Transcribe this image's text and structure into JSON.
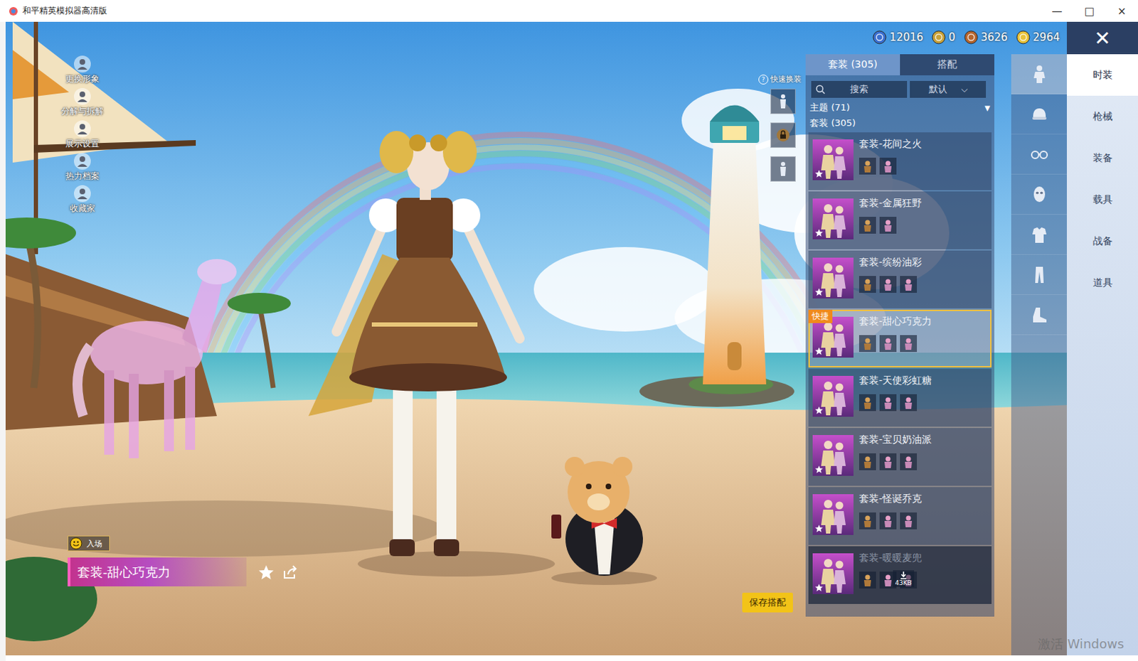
{
  "window": {
    "title": "和平精英模拟器高清版",
    "controls": [
      "—",
      "□",
      "×"
    ]
  },
  "left_menu": [
    {
      "label": "更换形象"
    },
    {
      "label": "分解与拆解"
    },
    {
      "label": "展示设置"
    },
    {
      "label": "热力档案"
    },
    {
      "label": "收藏家"
    }
  ],
  "currencies": [
    {
      "amount": "12016",
      "color": "#3a6fd0"
    },
    {
      "amount": "0",
      "color": "#c9a23a"
    },
    {
      "amount": "3626",
      "color": "#b5652e"
    },
    {
      "amount": "2964",
      "color": "#e8c23a"
    }
  ],
  "close": "✕",
  "quick_change": {
    "label": "快速换装",
    "help": "?",
    "slots": [
      {
        "locked": false
      },
      {
        "locked": true
      },
      {
        "locked": false
      }
    ]
  },
  "panel": {
    "tabs": [
      {
        "label": "套装 (305)",
        "selected": true
      },
      {
        "label": "搭配",
        "selected": false
      }
    ],
    "search": {
      "placeholder": "搜索"
    },
    "sort": {
      "value": "默认",
      "arrow": "⌵"
    },
    "theme_header": {
      "label": "主题 (71)",
      "arrow": "▼"
    },
    "list_header": "套装 (305)",
    "items": [
      {
        "name": "套装-花间之火",
        "parts": 2,
        "selected": false,
        "downloaded": true
      },
      {
        "name": "套装-金属狂野",
        "parts": 2,
        "selected": false,
        "downloaded": true
      },
      {
        "name": "套装-缤纷油彩",
        "parts": 3,
        "selected": false,
        "downloaded": true
      },
      {
        "name": "套装-甜心巧克力",
        "parts": 3,
        "selected": true,
        "downloaded": true,
        "badge": "快捷"
      },
      {
        "name": "套装-天使彩虹糖",
        "parts": 3,
        "selected": false,
        "downloaded": true
      },
      {
        "name": "套装-宝贝奶油派",
        "parts": 3,
        "selected": false,
        "downloaded": true
      },
      {
        "name": "套装-怪诞乔克",
        "parts": 3,
        "selected": false,
        "downloaded": true
      },
      {
        "name": "套装-暖暖麦兜",
        "parts": 3,
        "selected": false,
        "downloaded": false,
        "size": "43KB"
      }
    ]
  },
  "categories": [
    {
      "kind": "suit",
      "selected": true
    },
    {
      "kind": "helmet",
      "selected": false
    },
    {
      "kind": "glasses",
      "selected": false
    },
    {
      "kind": "mask",
      "selected": false
    },
    {
      "kind": "top",
      "selected": false
    },
    {
      "kind": "pants",
      "selected": false
    },
    {
      "kind": "shoes",
      "selected": false
    }
  ],
  "nav": [
    {
      "label": "时装",
      "selected": true
    },
    {
      "label": "枪械",
      "selected": false
    },
    {
      "label": "装备",
      "selected": false
    },
    {
      "label": "载具",
      "selected": false
    },
    {
      "label": "战备",
      "selected": false
    },
    {
      "label": "道具",
      "selected": false
    }
  ],
  "entrance": {
    "label": "入场"
  },
  "outfit_name": "套装-甜心巧克力",
  "save_button": "保存搭配",
  "watermark": "激活 Windows"
}
